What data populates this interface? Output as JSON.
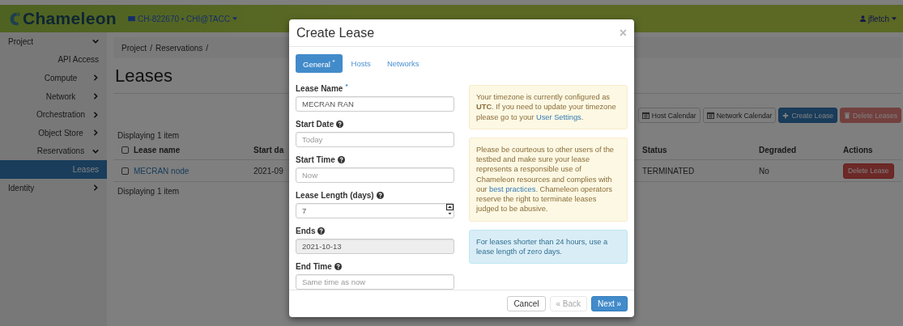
{
  "header": {
    "logo": "Chameleon",
    "project": "CH-822670 • CHI@TACC",
    "user": "jfletch"
  },
  "sidebar": {
    "items": [
      {
        "label": "Project",
        "expanded": true,
        "selected": false,
        "children": [
          {
            "label": "API Access",
            "selected": false
          },
          {
            "label": "Compute",
            "expanded": false,
            "selected": false
          },
          {
            "label": "Network",
            "expanded": false,
            "selected": false
          },
          {
            "label": "Orchestration",
            "expanded": false,
            "selected": false
          },
          {
            "label": "Object Store",
            "expanded": false,
            "selected": false
          },
          {
            "label": "Reservations",
            "expanded": true,
            "selected": false,
            "children": [
              {
                "label": "Leases",
                "selected": true
              }
            ]
          }
        ]
      },
      {
        "label": "Identity",
        "expanded": false,
        "selected": false
      }
    ]
  },
  "breadcrumb": {
    "items": [
      "Project",
      "Reservations"
    ],
    "separator": "/"
  },
  "page_title": "Leases",
  "toolbar": [
    {
      "label": "Host Calendar",
      "kind": "calendar",
      "disabled": false
    },
    {
      "label": "Network Calendar",
      "kind": "calendar",
      "disabled": false
    },
    {
      "label": "Create Lease",
      "kind": "create",
      "disabled": false
    },
    {
      "label": "Delete Leases",
      "kind": "delete",
      "disabled": true
    }
  ],
  "table": {
    "select_all_checked": false,
    "summary_top": "Displaying 1 item",
    "summary_bottom": "Displaying 1 item",
    "columns": [
      "Lease name",
      "Start da",
      "Status",
      "Degraded",
      "Actions"
    ],
    "rows": [
      {
        "checked": false,
        "name": "MECRAN node",
        "start": "2021-09",
        "status": "TERMINATED",
        "degraded": "No",
        "action": "Delete Lease"
      }
    ]
  },
  "modal": {
    "title": "Create Lease",
    "close": "×",
    "tabs": [
      {
        "label": "General",
        "mark": "*",
        "selected": true
      },
      {
        "label": "Hosts",
        "selected": false
      },
      {
        "label": "Networks",
        "selected": false
      }
    ],
    "fields": [
      {
        "label": "Lease Name",
        "mark": "*",
        "help": false,
        "kind": "text",
        "value": "MECRAN RAN",
        "disabled": false
      },
      {
        "label": "Start Date",
        "help": true,
        "kind": "text",
        "placeholder": "Today",
        "disabled": false
      },
      {
        "label": "Start Time",
        "help": true,
        "kind": "text",
        "placeholder": "Now",
        "disabled": false
      },
      {
        "label": "Lease Length (days)",
        "help": true,
        "kind": "number",
        "value": "7",
        "disabled": false
      },
      {
        "label": "Ends",
        "help": true,
        "kind": "text",
        "value": "2021-10-13",
        "disabled": true
      },
      {
        "label": "End Time",
        "help": true,
        "kind": "text",
        "placeholder": "Same time as now",
        "disabled": false
      }
    ],
    "notes": [
      {
        "kind": "warning",
        "text": "Your timezone is currently configured as **UTC**. If you need to update your timezone please go to your",
        "link": "User Settings",
        "after": "."
      },
      {
        "kind": "warning",
        "text": "Please be courteous to other users of the testbed and make sure your lease represents a responsible use of Chameleon resources and complies with our",
        "link": "best practices",
        "after": ". Chameleon operators reserve the right to terminate leases judged to be abusive."
      },
      {
        "kind": "info",
        "text": "For leases shorter than 24 hours, use a lease length of zero days."
      }
    ],
    "buttons": [
      {
        "label": "Cancel",
        "kind": "default",
        "disabled": false
      },
      {
        "label": "« Back",
        "kind": "default",
        "disabled": true
      },
      {
        "label": "Next »",
        "kind": "primary",
        "disabled": false
      }
    ]
  }
}
